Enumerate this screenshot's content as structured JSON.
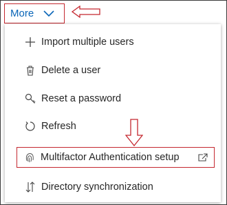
{
  "toolbar": {
    "more_label": "More"
  },
  "menu": {
    "items": [
      {
        "label": "Import multiple users",
        "icon": "plus-icon"
      },
      {
        "label": "Delete a user",
        "icon": "trash-icon"
      },
      {
        "label": "Reset a password",
        "icon": "key-icon"
      },
      {
        "label": "Refresh",
        "icon": "refresh-icon"
      },
      {
        "label": "Multifactor Authentication setup",
        "icon": "fingerprint-icon",
        "trailing_icon": "external-link-icon"
      },
      {
        "label": "Directory synchronization",
        "icon": "sync-arrows-icon"
      }
    ]
  },
  "colors": {
    "accent": "#0a66b8",
    "callout_red": "#c4262e",
    "text": "#262626"
  }
}
